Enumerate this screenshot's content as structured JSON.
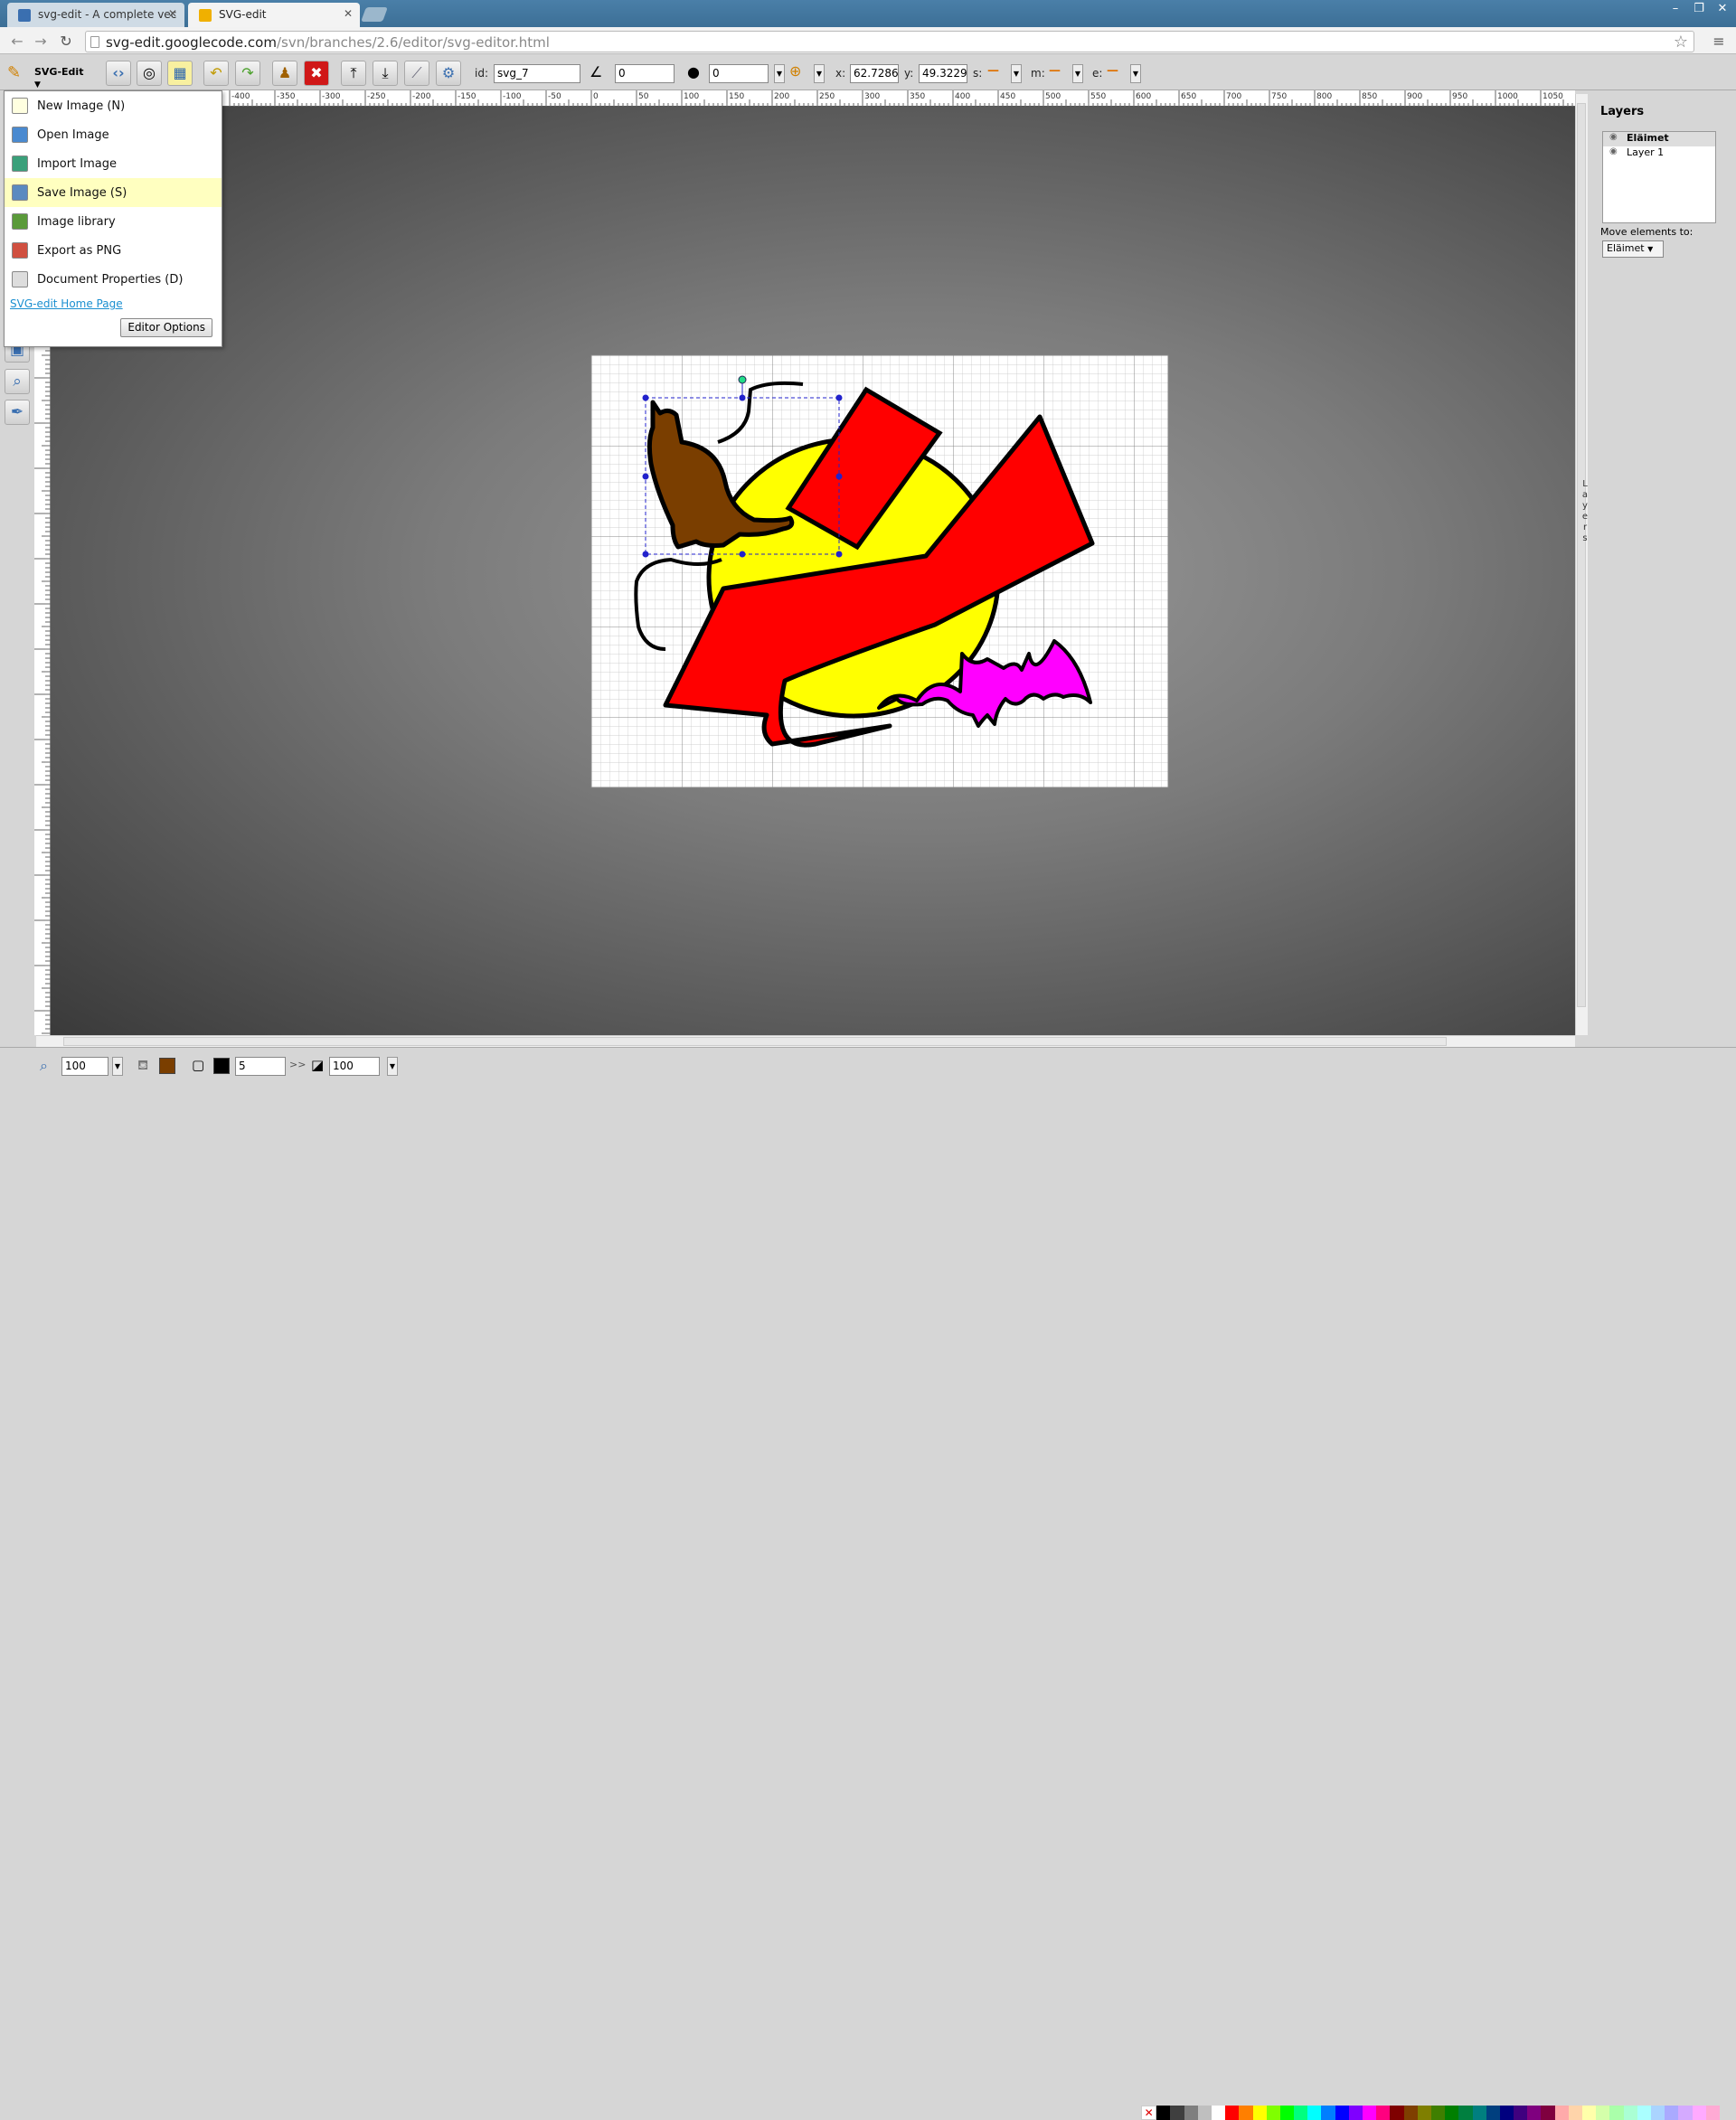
{
  "browser": {
    "tabs": [
      {
        "label": "svg-edit - A complete vec"
      },
      {
        "label": "SVG-edit"
      }
    ],
    "url_host": "svg-edit.googlecode.com",
    "url_path": "/svn/branches/2.6/editor/svg-editor.html"
  },
  "toolbar": {
    "app_menu_label": "SVG-Edit",
    "id_label": "id:",
    "id_value": "svg_7",
    "angle_value": "0",
    "blur_value": "0",
    "x_label": "x:",
    "x_value": "62.7286",
    "y_label": "y:",
    "y_value": "49.3229",
    "s_label": "s:",
    "m_label": "m:",
    "e_label": "e:"
  },
  "main_menu": {
    "items": [
      {
        "label": "New Image (N)",
        "icon": "new-image-icon"
      },
      {
        "label": "Open Image",
        "icon": "open-image-icon"
      },
      {
        "label": "Import Image",
        "icon": "import-image-icon"
      },
      {
        "label": "Save Image (S)",
        "icon": "save-image-icon"
      },
      {
        "label": "Image library",
        "icon": "image-library-icon"
      },
      {
        "label": "Export as PNG",
        "icon": "export-png-icon"
      },
      {
        "label": "Document Properties (D)",
        "icon": "document-properties-icon"
      }
    ],
    "home_link": "SVG-edit Home Page",
    "editor_options": "Editor Options"
  },
  "ruler": {
    "h_ticks": [
      "-400",
      "-350",
      "-300",
      "-250",
      "-200",
      "-150",
      "-100",
      "-50",
      "0",
      "50",
      "100",
      "150",
      "200",
      "250",
      "300",
      "350",
      "400",
      "450",
      "500",
      "550",
      "600",
      "650",
      "700",
      "750",
      "800",
      "850",
      "900",
      "950",
      "1000",
      "1050"
    ]
  },
  "layers_panel": {
    "title": "Layers",
    "layers": [
      "Eläimet",
      "Layer 1"
    ],
    "move_label": "Move elements to:",
    "move_value": "Eläimet",
    "side_tab": "Layers"
  },
  "bottom": {
    "zoom_value": "100",
    "stroke_width": "5",
    "opacity_value": "100",
    "overflow": ">>"
  },
  "colors": {
    "fill": "#7a3e00",
    "stroke": "#000000",
    "highlight": "#ffffc0",
    "palette": [
      "#000000",
      "#3f3f3f",
      "#7f7f7f",
      "#bfbfbf",
      "#ffffff",
      "#ff0000",
      "#ff7f00",
      "#ffff00",
      "#7fff00",
      "#00ff00",
      "#00ff7f",
      "#00ffff",
      "#007fff",
      "#0000ff",
      "#7f00ff",
      "#ff00ff",
      "#ff007f",
      "#7f0000",
      "#7f3f00",
      "#7f7f00",
      "#3f7f00",
      "#007f00",
      "#007f3f",
      "#007f7f",
      "#003f7f",
      "#00007f",
      "#3f007f",
      "#7f007f",
      "#7f003f",
      "#ffaaaa",
      "#ffd4aa",
      "#ffffaa",
      "#d4ffaa",
      "#aaffaa",
      "#aaffd4",
      "#aaffff",
      "#aad4ff",
      "#aaaaff",
      "#d4aaff",
      "#ffaaff",
      "#ffaad4"
    ]
  }
}
